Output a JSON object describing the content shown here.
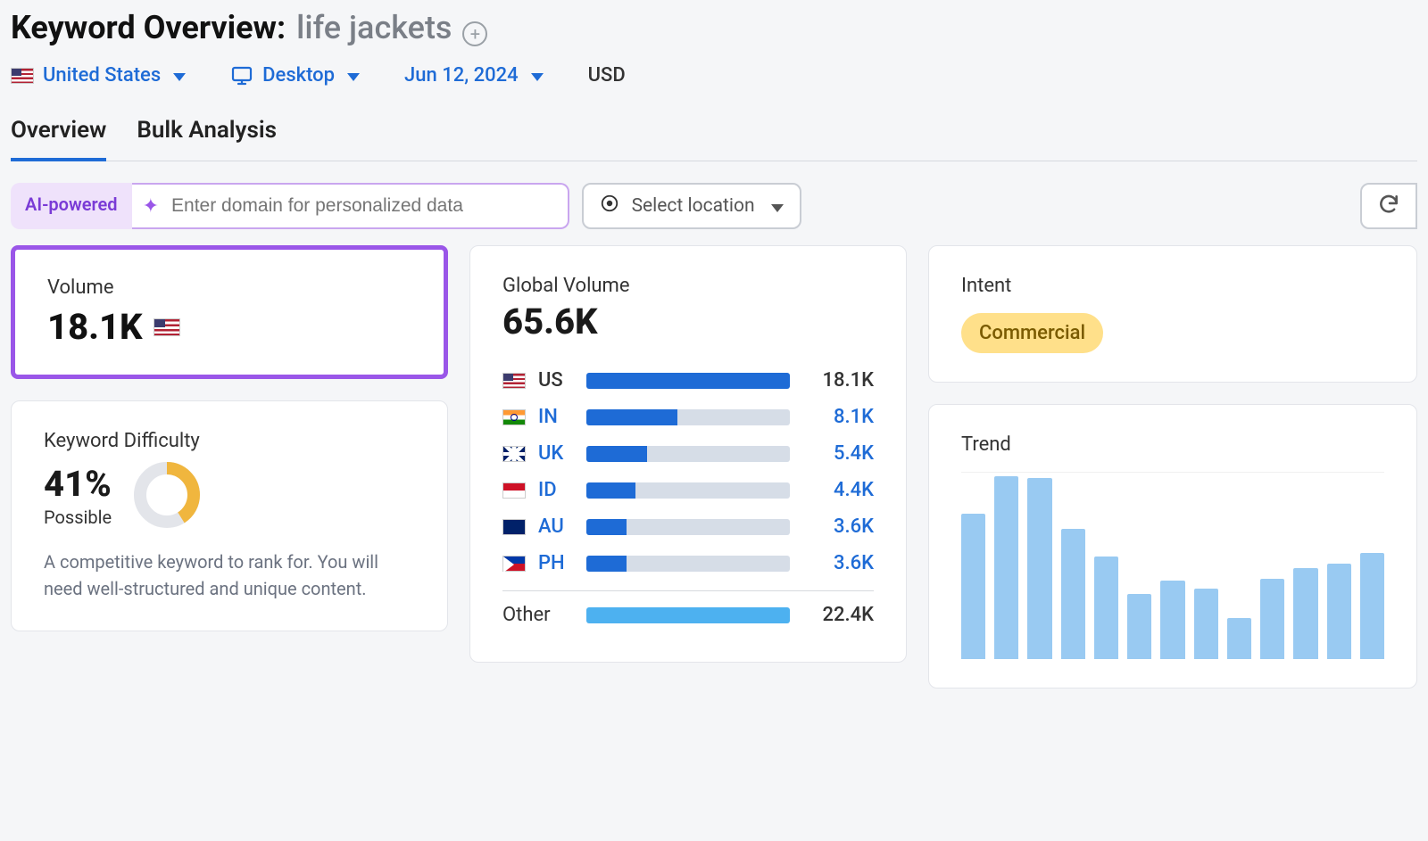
{
  "header": {
    "title_prefix": "Keyword Overview:",
    "keyword": "life jackets"
  },
  "filters": {
    "country": "United States",
    "device": "Desktop",
    "date": "Jun 12, 2024",
    "currency": "USD"
  },
  "tabs": {
    "overview": "Overview",
    "bulk": "Bulk Analysis",
    "active": "overview"
  },
  "controls": {
    "ai_badge": "AI-powered",
    "domain_placeholder": "Enter domain for personalized data",
    "location_placeholder": "Select location"
  },
  "volume": {
    "label": "Volume",
    "value": "18.1K"
  },
  "kd": {
    "label": "Keyword Difficulty",
    "percent_text": "41%",
    "percent_num": 41,
    "bucket": "Possible",
    "description": "A competitive keyword to rank for. You will need well-structured and unique content."
  },
  "global_volume": {
    "label": "Global Volume",
    "total": "65.6K",
    "max_share": 27.6,
    "countries": [
      {
        "cc": "US",
        "value": "18.1K",
        "share": 27.6,
        "flag": "flag-us",
        "primary": true
      },
      {
        "cc": "IN",
        "value": "8.1K",
        "share": 12.3,
        "flag": "flag-in"
      },
      {
        "cc": "UK",
        "value": "5.4K",
        "share": 8.2,
        "flag": "flag-uk"
      },
      {
        "cc": "ID",
        "value": "4.4K",
        "share": 6.7,
        "flag": "flag-id"
      },
      {
        "cc": "AU",
        "value": "3.6K",
        "share": 5.5,
        "flag": "flag-au"
      },
      {
        "cc": "PH",
        "value": "3.6K",
        "share": 5.5,
        "flag": "flag-ph"
      }
    ],
    "other": {
      "label": "Other",
      "value": "22.4K",
      "share": 34.1
    }
  },
  "intent": {
    "label": "Intent",
    "value": "Commercial"
  },
  "trend": {
    "label": "Trend"
  },
  "chart_data": {
    "type": "bar",
    "title": "Trend",
    "xlabel": "",
    "ylabel": "",
    "categories": [
      "1",
      "2",
      "3",
      "4",
      "5",
      "6",
      "7",
      "8",
      "9",
      "10",
      "11",
      "12"
    ],
    "values": [
      78,
      98,
      97,
      70,
      55,
      35,
      42,
      38,
      22,
      43,
      49,
      51,
      57
    ],
    "ylim": [
      0,
      100
    ]
  }
}
